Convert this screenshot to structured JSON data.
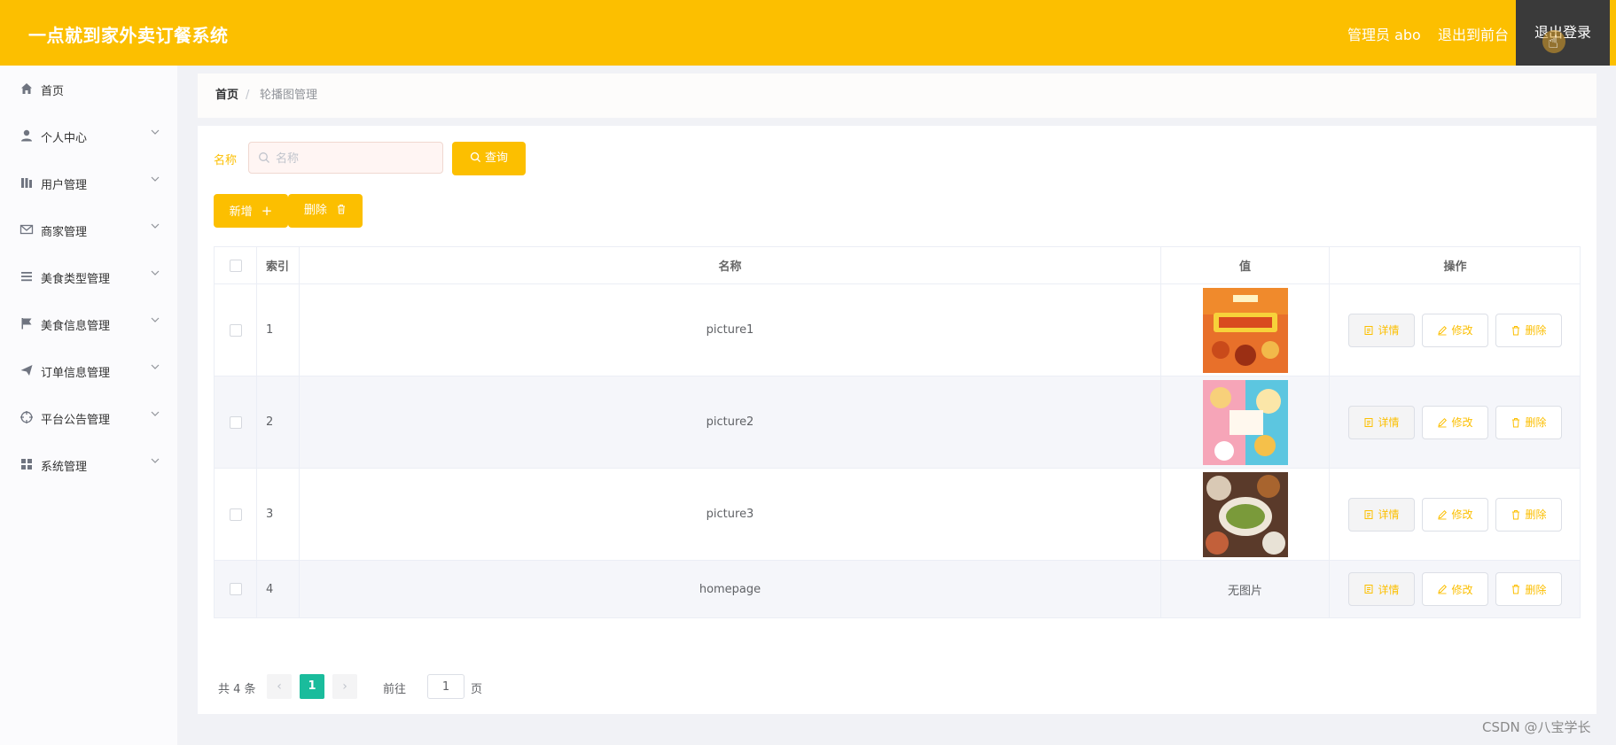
{
  "header": {
    "title": "一点就到家外卖订餐系统",
    "admin_label": "管理员 abo",
    "to_front_label": "退出到前台",
    "logout_label": "退出登录",
    "bg_color": "#fcbf00"
  },
  "sidebar": {
    "items": [
      {
        "label": "首页",
        "icon": "home-icon",
        "has_arrow": false
      },
      {
        "label": "个人中心",
        "icon": "user-icon",
        "has_arrow": true
      },
      {
        "label": "用户管理",
        "icon": "bars-icon",
        "has_arrow": true
      },
      {
        "label": "商家管理",
        "icon": "mail-icon",
        "has_arrow": true
      },
      {
        "label": "美食类型管理",
        "icon": "list-icon",
        "has_arrow": true
      },
      {
        "label": "美食信息管理",
        "icon": "flag-icon",
        "has_arrow": true
      },
      {
        "label": "订单信息管理",
        "icon": "send-icon",
        "has_arrow": true
      },
      {
        "label": "平台公告管理",
        "icon": "crosshair-icon",
        "has_arrow": true
      },
      {
        "label": "系统管理",
        "icon": "grid-icon",
        "has_arrow": true
      }
    ]
  },
  "breadcrumb": {
    "home": "首页",
    "separator": "/",
    "current": "轮播图管理"
  },
  "search": {
    "label": "名称",
    "placeholder": "名称",
    "value": "",
    "query_button": "查询"
  },
  "actions": {
    "add_button": "新增",
    "delete_button": "删除"
  },
  "table": {
    "headers": {
      "index": "索引",
      "name": "名称",
      "value": "值",
      "ops": "操作"
    },
    "rows": [
      {
        "index": "1",
        "name": "picture1",
        "value_text": "",
        "image": "promo-poster"
      },
      {
        "index": "2",
        "name": "picture2",
        "value_text": "",
        "image": "japanese-food"
      },
      {
        "index": "3",
        "name": "picture3",
        "value_text": "",
        "image": "dishes-table"
      },
      {
        "index": "4",
        "name": "homepage",
        "value_text": "无图片",
        "image": ""
      }
    ],
    "row_ops": {
      "detail": "详情",
      "edit": "修改",
      "delete": "删除"
    }
  },
  "pagination": {
    "total": "共 4 条",
    "current_page": "1",
    "goto_label": "前往",
    "goto_value": "1",
    "page_unit": "页"
  },
  "watermark": "CSDN @八宝学长",
  "colors": {
    "accent": "#fcbf00",
    "pager_active": "#1abc9c",
    "logout_bg": "#3a3a3a"
  }
}
